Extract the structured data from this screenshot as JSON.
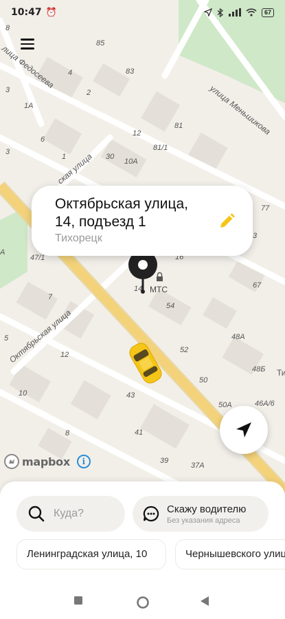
{
  "status_bar": {
    "time": "10:47",
    "alarm_icon": "alarm-icon",
    "battery": "67"
  },
  "map": {
    "labels": [
      {
        "text": "8"
      },
      {
        "text": "85"
      },
      {
        "text": "лица Федосеева"
      },
      {
        "text": "83"
      },
      {
        "text": "4"
      },
      {
        "text": "3"
      },
      {
        "text": "2"
      },
      {
        "text": "улица Меньшикова"
      },
      {
        "text": "1А"
      },
      {
        "text": "81"
      },
      {
        "text": "12"
      },
      {
        "text": "6"
      },
      {
        "text": "81/1"
      },
      {
        "text": "3"
      },
      {
        "text": "1"
      },
      {
        "text": "30"
      },
      {
        "text": "10А"
      },
      {
        "text": "ская улица"
      },
      {
        "text": "77"
      },
      {
        "text": "3"
      },
      {
        "text": "А"
      },
      {
        "text": "47/1"
      },
      {
        "text": "16"
      },
      {
        "text": "7"
      },
      {
        "text": "67"
      },
      {
        "text": "14"
      },
      {
        "text": "МТС"
      },
      {
        "text": "54"
      },
      {
        "text": "Октябрьская улица"
      },
      {
        "text": "48А"
      },
      {
        "text": "5"
      },
      {
        "text": "12"
      },
      {
        "text": "52"
      },
      {
        "text": "48Б"
      },
      {
        "text": "Ти"
      },
      {
        "text": "50"
      },
      {
        "text": "10"
      },
      {
        "text": "43"
      },
      {
        "text": "50А"
      },
      {
        "text": "46А/6"
      },
      {
        "text": "8"
      },
      {
        "text": "41"
      },
      {
        "text": "39"
      },
      {
        "text": "37А"
      }
    ],
    "attribution": "mapbox",
    "info_label": "i"
  },
  "address_card": {
    "line1": "Октябрьская улица,",
    "line2": "14, подъезд 1",
    "city": "Тихорецк"
  },
  "bottom_sheet": {
    "where_placeholder": "Куда?",
    "driver_title": "Скажу водителю",
    "driver_subtitle": "Без указания адреса",
    "suggestions": [
      "Ленинградская улица, 10",
      "Чернышевского улица"
    ]
  },
  "colors": {
    "accent": "#f5c518",
    "road_main": "#f3d27a",
    "park": "#cfe8c8"
  }
}
